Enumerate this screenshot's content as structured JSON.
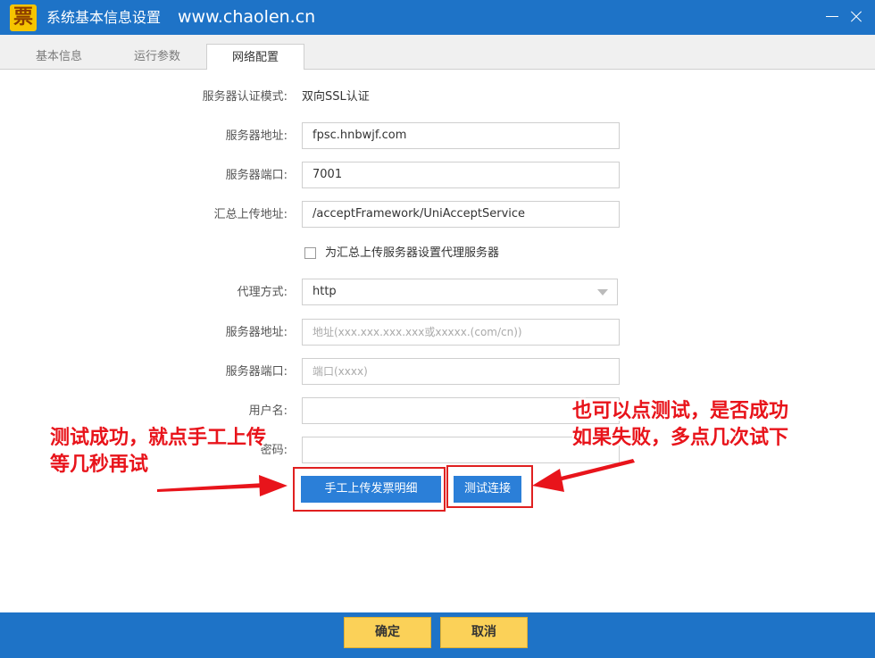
{
  "window": {
    "logo_char": "票",
    "title": "系统基本信息设置",
    "url": "www.chaolen.cn"
  },
  "tabs": [
    {
      "label": "基本信息",
      "active": false
    },
    {
      "label": "运行参数",
      "active": false
    },
    {
      "label": "网络配置",
      "active": true
    }
  ],
  "form": {
    "auth_mode_label": "服务器认证模式:",
    "auth_mode_value": "双向SSL认证",
    "server_address_label": "服务器地址:",
    "server_address_value": "fpsc.hnbwjf.com",
    "server_port_label": "服务器端口:",
    "server_port_value": "7001",
    "upload_address_label": "汇总上传地址:",
    "upload_address_value": "/acceptFramework/UniAcceptService",
    "proxy_checkbox_label": "为汇总上传服务器设置代理服务器",
    "proxy_checked": false,
    "proxy_type_label": "代理方式:",
    "proxy_type_value": "http",
    "proxy_address_label": "服务器地址:",
    "proxy_address_placeholder": "地址(xxx.xxx.xxx.xxx或xxxxx.(com/cn))",
    "proxy_port_label": "服务器端口:",
    "proxy_port_placeholder": "端口(xxxx)",
    "username_label": "用户名:",
    "password_label": "密码:"
  },
  "actions": {
    "upload_label": "手工上传发票明细",
    "test_label": "测试连接"
  },
  "annotations": {
    "left_line1": "测试成功，就点手工上传",
    "left_line2": "等几秒再试",
    "right_line1": "也可以点测试，是否成功",
    "right_line2": "如果失败，多点几次试下"
  },
  "footer": {
    "ok_label": "确定",
    "cancel_label": "取消"
  },
  "colors": {
    "title_bar": "#1e73c7",
    "button_blue": "#2b7fd8",
    "button_yellow": "#fbd158",
    "annotation_red": "#e8141b"
  }
}
